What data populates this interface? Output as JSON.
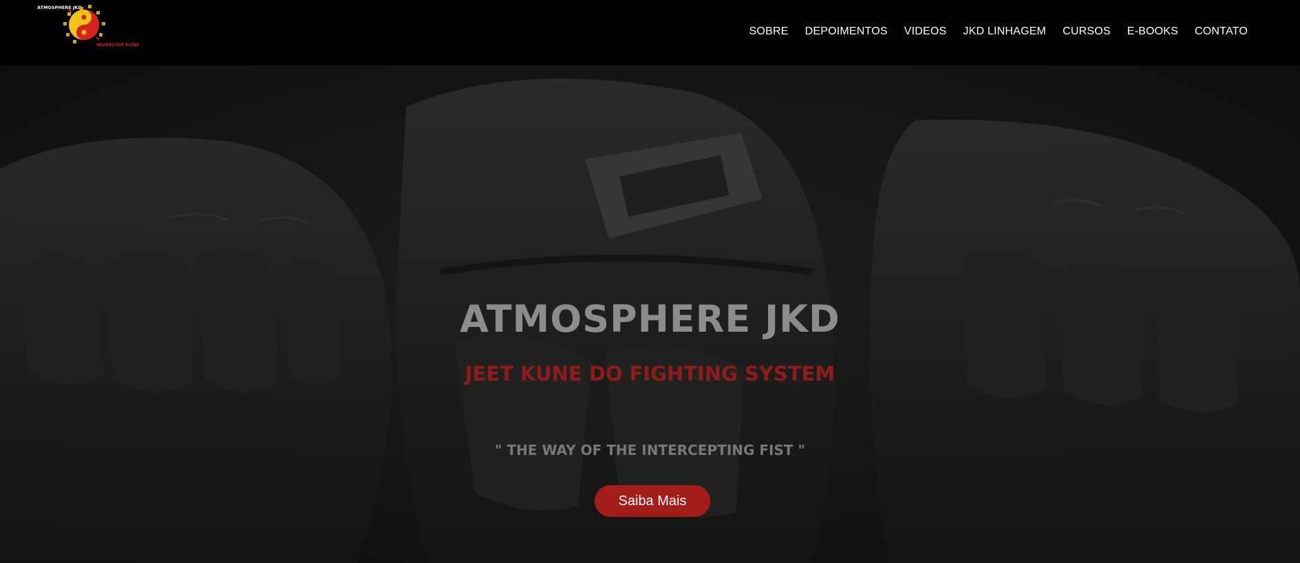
{
  "logo": {
    "brand_text": "ATMOSPHERE JKD",
    "tagline": "NEVERSTOP FLOW",
    "icon": "yin-yang-jkd-emblem",
    "colors": {
      "red": "#d4231d",
      "yellow": "#f2c21b",
      "gold": "#c9a227"
    }
  },
  "nav": {
    "items": [
      {
        "label": "SOBRE"
      },
      {
        "label": "DEPOIMENTOS"
      },
      {
        "label": "VIDEOS"
      },
      {
        "label": "JKD LINHAGEM"
      },
      {
        "label": "CURSOS"
      },
      {
        "label": "E-BOOKS"
      },
      {
        "label": "CONTATO"
      }
    ]
  },
  "hero": {
    "background": "boxing-gloves-photo",
    "title": "ATMOSPHERE JKD",
    "subtitle": "JEET KUNE DO FIGHTING SYSTEM",
    "quote": "\" THE WAY OF THE INTERCEPTING FIST \"",
    "cta_label": "Saiba Mais",
    "colors": {
      "title": "#8e8c8b",
      "subtitle": "#8f1c1c",
      "cta": "#a51d1a"
    }
  }
}
